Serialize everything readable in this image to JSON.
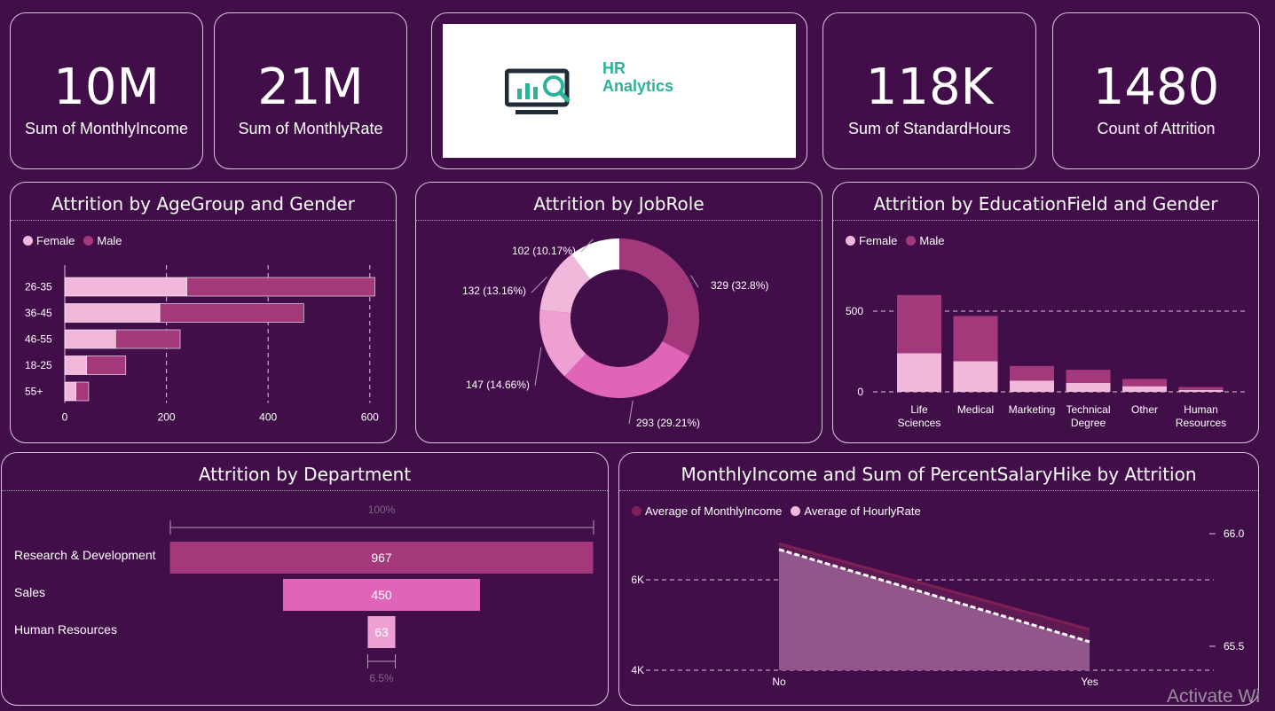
{
  "colors": {
    "background": "#420e4a",
    "border": "#d9c6dd",
    "female": "#f2b8db",
    "male": "#a3387a",
    "pink_mid": "#e065b8",
    "pink_light": "#eea0d2"
  },
  "kpis": [
    {
      "value": "10M",
      "label": "Sum of MonthlyIncome"
    },
    {
      "value": "21M",
      "label": "Sum of MonthlyRate"
    },
    {
      "value": "118K",
      "label": "Sum of StandardHours"
    },
    {
      "value": "1480",
      "label": "Count of Attrition"
    }
  ],
  "logo": {
    "line1": "HR",
    "line2": "Analytics",
    "icon": "monitor-chart-magnifier-icon"
  },
  "age_chart": {
    "title": "Attrition by AgeGroup and Gender",
    "legend": [
      "Female",
      "Male"
    ],
    "x_ticks": [
      "0",
      "200",
      "400",
      "600"
    ]
  },
  "jobrole_chart": {
    "title": "Attrition by JobRole",
    "labels": [
      "329 (32.8%)",
      "293 (29.21%)",
      "147 (14.66%)",
      "132 (13.16%)",
      "102 (10.17%)"
    ]
  },
  "edu_chart": {
    "title": "Attrition by EducationField and Gender",
    "legend": [
      "Female",
      "Male"
    ],
    "y_ticks": [
      "500",
      "0"
    ]
  },
  "dept_chart": {
    "title": "Attrition by Department",
    "top_pct": "100%",
    "bottom_pct": "6.5%"
  },
  "income_chart": {
    "title": "MonthlyIncome and Sum of PercentSalaryHike by Attrition",
    "legend": [
      "Average of MonthlyIncome",
      "Average of HourlyRate"
    ],
    "y_left_ticks": [
      "6K",
      "4K"
    ],
    "y_right_ticks": [
      "66.0",
      "65.5"
    ]
  },
  "watermark": "Activate Wi",
  "chart_data": [
    {
      "type": "bar",
      "orientation": "horizontal",
      "stacked": true,
      "title": "Attrition by AgeGroup and Gender",
      "categories": [
        "26-35",
        "36-45",
        "46-55",
        "18-25",
        "55+"
      ],
      "series": [
        {
          "name": "Female",
          "values": [
            240,
            187,
            100,
            43,
            22
          ]
        },
        {
          "name": "Male",
          "values": [
            370,
            283,
            127,
            77,
            25
          ]
        }
      ],
      "xlim": [
        0,
        620
      ],
      "legend": "top-left",
      "grid": true
    },
    {
      "type": "pie",
      "donut": true,
      "title": "Attrition by JobRole",
      "values": [
        329,
        293,
        147,
        132,
        102
      ],
      "labels": [
        "329 (32.8%)",
        "293 (29.21%)",
        "147 (14.66%)",
        "132 (13.16%)",
        "102 (10.17%)"
      ],
      "colors": [
        "#a3387a",
        "#e065b8",
        "#eea0d2",
        "#f2b8db",
        "#ffffff"
      ]
    },
    {
      "type": "bar",
      "stacked": true,
      "title": "Attrition by EducationField and Gender",
      "categories": [
        "Life Sciences",
        "Medical",
        "Marketing",
        "Technical Degree",
        "Other",
        "Human Resources"
      ],
      "series": [
        {
          "name": "Female",
          "values": [
            240,
            190,
            70,
            55,
            35,
            12
          ]
        },
        {
          "name": "Male",
          "values": [
            360,
            280,
            90,
            82,
            45,
            18
          ]
        }
      ],
      "ylim": [
        0,
        620
      ],
      "legend": "top-left",
      "grid": true
    },
    {
      "type": "bar",
      "subtype": "funnel",
      "title": "Attrition by Department",
      "categories": [
        "Research & Development",
        "Sales",
        "Human Resources"
      ],
      "values": [
        967,
        450,
        63
      ]
    },
    {
      "type": "area",
      "title": "MonthlyIncome and Sum of PercentSalaryHike by Attrition",
      "x": [
        "No",
        "Yes"
      ],
      "series": [
        {
          "name": "Average of MonthlyIncome",
          "axis": "left",
          "values": [
            6800,
            4900
          ]
        },
        {
          "name": "Average of HourlyRate",
          "axis": "right",
          "values": [
            65.93,
            65.52
          ]
        }
      ],
      "ylim_left": [
        4000,
        7000
      ],
      "ylim_right": [
        65.4,
        66.05
      ],
      "legend": "top-left",
      "grid": true
    }
  ]
}
